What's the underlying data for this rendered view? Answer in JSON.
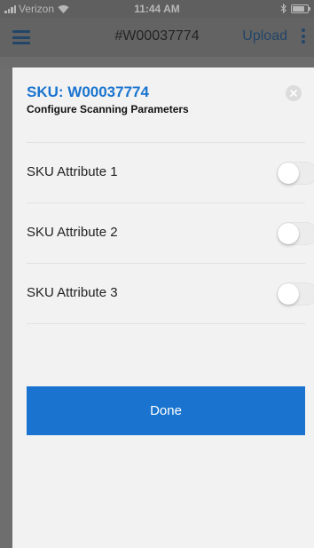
{
  "status_bar": {
    "carrier": "Verizon",
    "time": "11:44 AM"
  },
  "nav": {
    "title": "#W00037774",
    "upload_label": "Upload",
    "icons": [
      "hamburger-menu-icon",
      "more-vertical-icon"
    ]
  },
  "modal": {
    "title": "SKU: W00037774",
    "subtitle": "Configure Scanning Parameters",
    "close_icon": "close-icon",
    "attributes": [
      {
        "label": "SKU Attribute 1",
        "enabled": false
      },
      {
        "label": "SKU Attribute 2",
        "enabled": false
      },
      {
        "label": "SKU Attribute 3",
        "enabled": false
      }
    ],
    "done_label": "Done"
  },
  "colors": {
    "accent": "#1a74cf",
    "nav_dimmed": "#636363",
    "modal_background": "#f2f2f2"
  }
}
